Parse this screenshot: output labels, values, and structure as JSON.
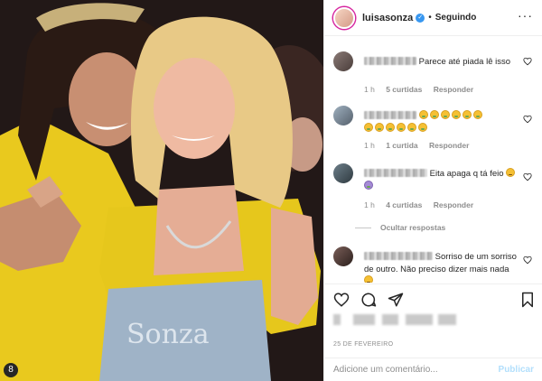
{
  "post": {
    "image_alt": "Photo post",
    "corner_badge": "8"
  },
  "header": {
    "username": "luisasonza",
    "verified_icon": "verified-badge-icon",
    "separator": "•",
    "follow_status": "Seguindo",
    "more_icon": "more-options-icon",
    "more_label": "..."
  },
  "comments": [
    {
      "user": "j_____ ___",
      "text": "Parece até piada lê isso",
      "time": "1 h",
      "likes": "5 curtidas",
      "reply": "Responder"
    },
    {
      "user": "j_____s",
      "text": "",
      "emojis": [
        "nauseated-face",
        "nauseated-face",
        "nauseated-face",
        "nauseated-face",
        "nauseated-face",
        "nauseated-face",
        "nauseated-face",
        "nauseated-face",
        "nauseated-face",
        "nauseated-face",
        "nauseated-face",
        "nauseated-face"
      ],
      "time": "1 h",
      "likes": "1 curtida",
      "reply": "Responder"
    },
    {
      "user": "______ ___p____",
      "text": "Eita apaga q tá feio",
      "emojis": [
        "unamused-face",
        "woman-facepalming"
      ],
      "time": "1 h",
      "likes": "4 curtidas",
      "reply": "Responder"
    },
    {
      "user": "____g____ ____",
      "text": "Sorriso de um sorriso de outro. Não preciso dizer mais nada",
      "emojis": [
        "thinking-face"
      ]
    }
  ],
  "hide_replies": "Ocultar respostas",
  "actions": {
    "like_icon": "heart-icon",
    "comment_icon": "comment-icon",
    "share_icon": "share-icon",
    "save_icon": "bookmark-icon"
  },
  "date": "25 DE FEVEREIRO",
  "add_comment": {
    "placeholder": "Adicione um comentário...",
    "publish_label": "Publicar"
  },
  "colors": {
    "accent_blue": "#3897f0",
    "publish_disabled": "#b2dffc",
    "meta_gray": "#8e8e8e",
    "text": "#262626"
  }
}
